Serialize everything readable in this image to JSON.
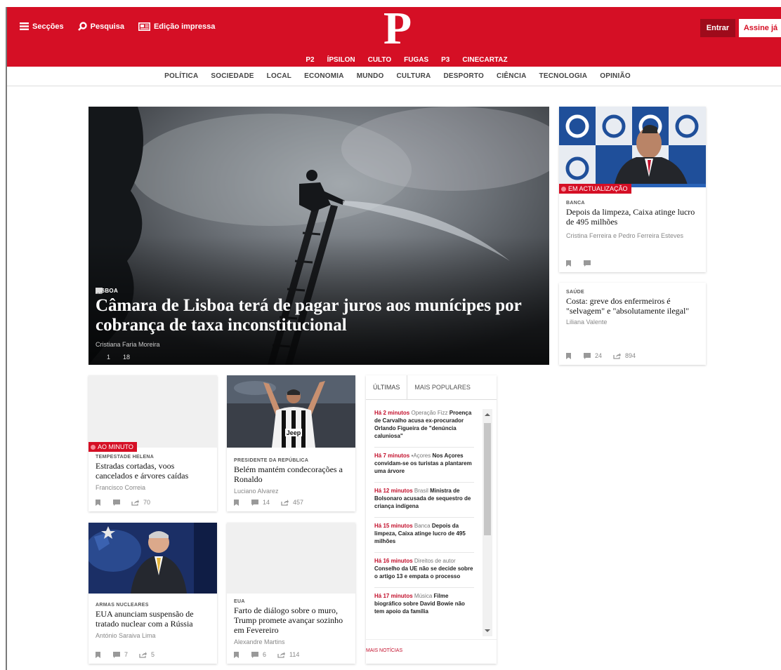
{
  "header": {
    "tools": [
      {
        "label": "Secções",
        "icon": "menu-icon"
      },
      {
        "label": "Pesquisa",
        "icon": "search-icon"
      },
      {
        "label": "Edição impressa",
        "icon": "newspaper-icon"
      }
    ],
    "logo": "P",
    "login_label": "Entrar",
    "subscribe_label": "Assine já",
    "brand_color": "#d50f25",
    "subnav": [
      "P2",
      "ÍPSILON",
      "CULTO",
      "FUGAS",
      "P3",
      "CINECARTAZ"
    ]
  },
  "sections": [
    "POLÍTICA",
    "SOCIEDADE",
    "LOCAL",
    "ECONOMIA",
    "MUNDO",
    "CULTURA",
    "DESPORTO",
    "CIÊNCIA",
    "TECNOLOGIA",
    "OPINIÃO"
  ],
  "hero": {
    "kicker": "LISBOA",
    "title": "Câmara de Lisboa terá de pagar juros aos munícipes por cobrança de taxa inconstitucional",
    "author": "Cristiana Faria Moreira",
    "comments": "1",
    "shares": "18"
  },
  "side_cards": [
    {
      "badge": "EM ACTUALIZAÇÃO",
      "kicker": "BANCA",
      "title": "Depois da limpeza, Caixa atinge lucro de 495 milhões",
      "author": "Cristina Ferreira e Pedro Ferreira Esteves"
    },
    {
      "kicker": "SAÚDE",
      "title": "Costa: greve dos enfermeiros é \"selvagem\" e \"absolutamente ilegal\"",
      "author": "Liliana Valente",
      "comments": "24",
      "shares": "894"
    }
  ],
  "grid_cards": [
    {
      "badge": "AO MINUTO",
      "kicker": "TEMPESTADE HELENA",
      "title": "Estradas cortadas, voos cancelados e árvores caídas",
      "author": "Francisco Correia",
      "shares": "70"
    },
    {
      "kicker": "PRESIDENTE DA REPÚBLICA",
      "title": "Belém mantém condecorações a Ronaldo",
      "author": "Luciano Alvarez",
      "comments": "14",
      "shares": "457"
    },
    {
      "kicker": "ARMAS NUCLEARES",
      "title": "EUA anunciam suspensão de tratado nuclear com a Rússia",
      "author": "António Saraiva Lima",
      "comments": "7",
      "shares": "5"
    },
    {
      "kicker": "EUA",
      "title": "Farto de diálogo sobre o muro, Trump promete avançar sozinho em Fevereiro",
      "author": "Alexandre Martins",
      "comments": "6",
      "shares": "114"
    }
  ],
  "latest": {
    "tab_active": "ÚLTIMAS",
    "tab_other": "MAIS POPULARES",
    "items": [
      {
        "time": "Há 2 minutos",
        "section": "Operação Fizz",
        "title": "Proença de Carvalho acusa ex-procurador Orlando Figueira de \"denúncia caluniosa\""
      },
      {
        "time": "Há 7 minutos",
        "section": "Açores",
        "title": "Nos Açores convidam-se os turistas a plantarem uma árvore"
      },
      {
        "time": "Há 12 minutos",
        "section": "Brasil",
        "title": "Ministra de Bolsonaro acusada de sequestro de criança indígena"
      },
      {
        "time": "Há 15 minutos",
        "section": "Banca",
        "title": "Depois da limpeza, Caixa atinge lucro de 495 milhões"
      },
      {
        "time": "Há 16 minutos",
        "section": "Direitos de autor",
        "title": "Conselho da UE não se decide sobre o artigo 13 e empata o processo"
      },
      {
        "time": "Há 17 minutos",
        "section": "Música",
        "title": "Filme biográfico sobre David Bowie não tem apoio da família"
      }
    ],
    "more_label": "MAIS NOTÍCIAS"
  }
}
